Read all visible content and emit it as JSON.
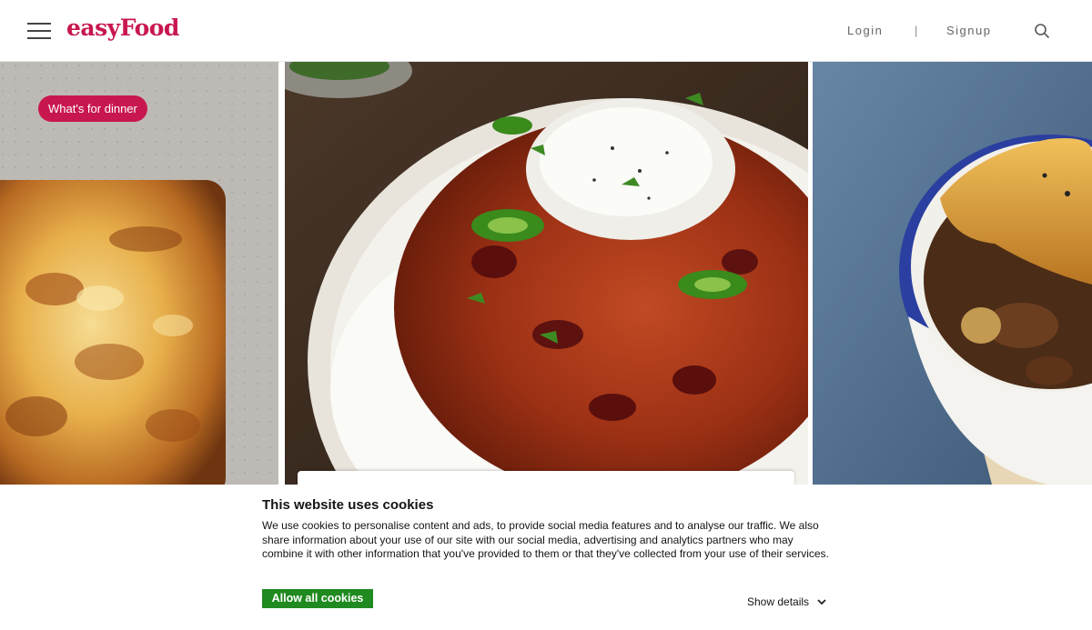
{
  "header": {
    "logo": "easyFood",
    "login_label": "Login",
    "separator": "|",
    "signup_label": "Signup",
    "brand_color": "#c8174f",
    "icons": [
      "menu-icon",
      "search-icon"
    ]
  },
  "hero": {
    "badge": "What's for dinner",
    "panels": [
      "lasagne-image",
      "chilli-con-carne-image",
      "beef-pie-image"
    ]
  },
  "cookie_banner": {
    "title": "This website uses cookies",
    "text": "We use cookies to personalise content and ads, to provide social media features and to analyse our traffic. We also share information about your use of our site with our social media, advertising and analytics partners who may combine it with other information that you've provided to them or that they've collected from your use of their services.",
    "allow_label": "Allow all cookies",
    "details_label": "Show details",
    "accent": "#1f8a1f"
  }
}
